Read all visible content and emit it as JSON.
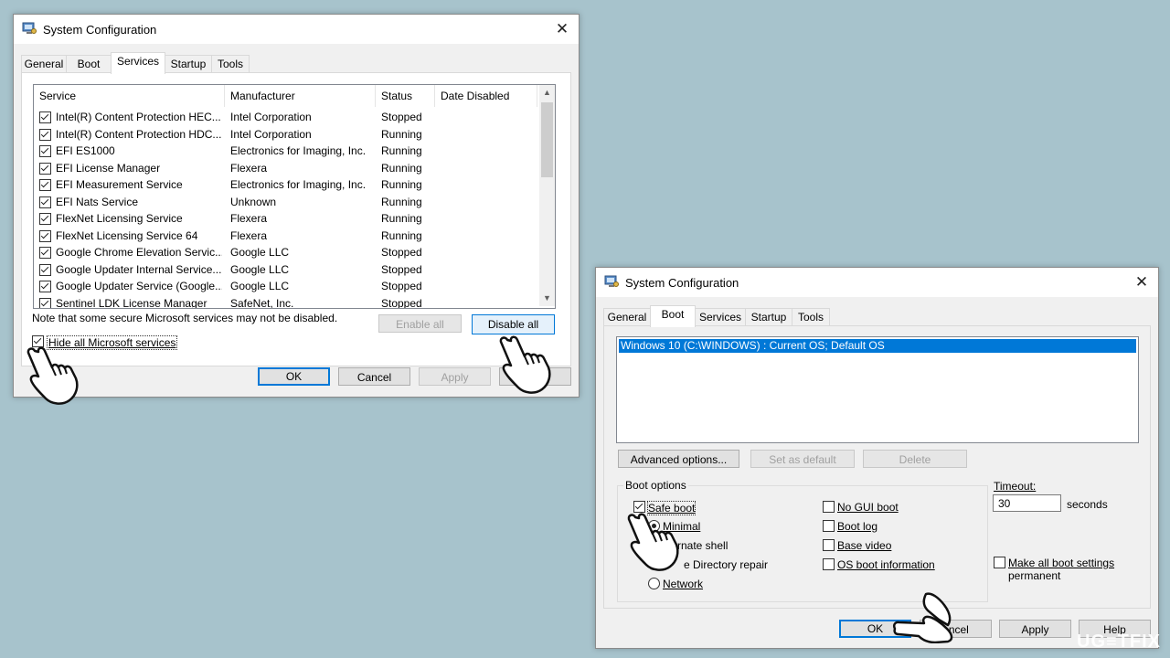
{
  "dialog1": {
    "title": "System Configuration",
    "close": "✕",
    "tabs": [
      "General",
      "Boot",
      "Services",
      "Startup",
      "Tools"
    ],
    "active_tab": "Services",
    "columns": [
      "Service",
      "Manufacturer",
      "Status",
      "Date Disabled"
    ],
    "services": [
      {
        "name": "Intel(R) Content Protection HEC...",
        "manufacturer": "Intel Corporation",
        "status": "Stopped",
        "checked": true
      },
      {
        "name": "Intel(R) Content Protection HDC...",
        "manufacturer": "Intel Corporation",
        "status": "Running",
        "checked": true
      },
      {
        "name": "EFI ES1000",
        "manufacturer": "Electronics for Imaging, Inc.",
        "status": "Running",
        "checked": true
      },
      {
        "name": "EFI License Manager",
        "manufacturer": "Flexera",
        "status": "Running",
        "checked": true
      },
      {
        "name": "EFI Measurement Service",
        "manufacturer": "Electronics for Imaging, Inc.",
        "status": "Running",
        "checked": true
      },
      {
        "name": "EFI Nats Service",
        "manufacturer": "Unknown",
        "status": "Running",
        "checked": true
      },
      {
        "name": "FlexNet Licensing Service",
        "manufacturer": "Flexera",
        "status": "Running",
        "checked": true
      },
      {
        "name": "FlexNet Licensing Service 64",
        "manufacturer": "Flexera",
        "status": "Running",
        "checked": true
      },
      {
        "name": "Google Chrome Elevation Servic...",
        "manufacturer": "Google LLC",
        "status": "Stopped",
        "checked": true
      },
      {
        "name": "Google Updater Internal Service...",
        "manufacturer": "Google LLC",
        "status": "Stopped",
        "checked": true
      },
      {
        "name": "Google Updater Service (Google...",
        "manufacturer": "Google LLC",
        "status": "Stopped",
        "checked": true
      },
      {
        "name": "Sentinel LDK License Manager",
        "manufacturer": "SafeNet, Inc.",
        "status": "Stopped",
        "checked": true
      }
    ],
    "note": "Note that some secure Microsoft services may not be disabled.",
    "enable_all": "Enable all",
    "disable_all": "Disable all",
    "hide_ms": {
      "label": "Hide all Microsoft services",
      "checked": true
    },
    "ok": "OK",
    "cancel": "Cancel",
    "apply": "Apply"
  },
  "dialog2": {
    "title": "System Configuration",
    "close": "✕",
    "tabs": [
      "General",
      "Boot",
      "Services",
      "Startup",
      "Tools"
    ],
    "active_tab": "Boot",
    "os_entry": "Windows 10 (C:\\WINDOWS) : Current OS; Default OS",
    "advanced_options": "Advanced options...",
    "set_as_default": "Set as default",
    "delete": "Delete",
    "boot_options_title": "Boot options",
    "safe_boot": {
      "label": "Safe boot",
      "checked": true
    },
    "minimal": "Minimal",
    "alternate_shell": "rnate shell",
    "ad_repair": "e Directory repair",
    "network": "Network",
    "no_gui_boot": "No GUI boot",
    "boot_log": "Boot log",
    "base_video": "Base video",
    "os_boot_info": "OS boot information",
    "timeout_label": "Timeout:",
    "timeout_value": "30",
    "seconds": "seconds",
    "make_permanent_1": "Make all boot settings",
    "make_permanent_2": "permanent",
    "ok": "OK",
    "cancel": "ancel",
    "apply": "Apply",
    "help": "Help"
  },
  "watermark": "UG≡TFIX",
  "colors": {
    "background": "#a7c3cc",
    "accent": "#0078d7",
    "dialog": "#f0f0f0"
  }
}
